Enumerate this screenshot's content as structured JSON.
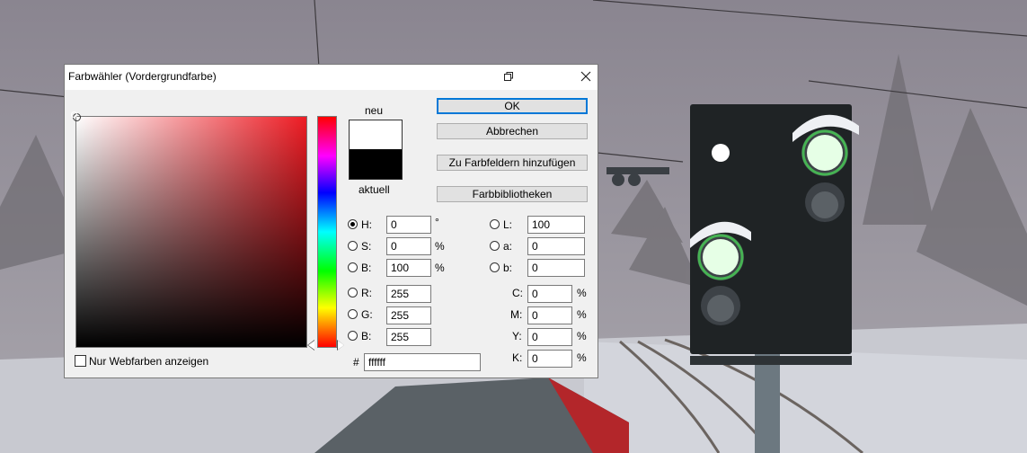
{
  "dialog": {
    "title": "Farbwähler (Vordergrundfarbe)",
    "buttons": {
      "ok": "OK",
      "cancel": "Abbrechen",
      "add_to_swatches": "Zu Farbfeldern hinzufügen",
      "color_libraries": "Farbbibliotheken"
    },
    "preview": {
      "new_label": "neu",
      "current_label": "aktuell",
      "new_color": "#ffffff",
      "current_color": "#000000"
    },
    "webcolors_label": "Nur Webfarben anzeigen",
    "webcolors_checked": false,
    "selected_hue_color": "#ee1c24",
    "hsb": {
      "h": {
        "label": "H:",
        "value": "0",
        "unit": "°",
        "selected": true
      },
      "s": {
        "label": "S:",
        "value": "0",
        "unit": "%"
      },
      "b": {
        "label": "B:",
        "value": "100",
        "unit": "%"
      }
    },
    "rgb": {
      "r": {
        "label": "R:",
        "value": "255"
      },
      "g": {
        "label": "G:",
        "value": "255"
      },
      "b": {
        "label": "B:",
        "value": "255"
      }
    },
    "lab": {
      "l": {
        "label": "L:",
        "value": "100"
      },
      "a": {
        "label": "a:",
        "value": "0"
      },
      "b": {
        "label": "b:",
        "value": "0"
      }
    },
    "cmyk": {
      "c": {
        "label": "C:",
        "value": "0",
        "unit": "%"
      },
      "m": {
        "label": "M:",
        "value": "0",
        "unit": "%"
      },
      "y": {
        "label": "Y:",
        "value": "0",
        "unit": "%"
      },
      "k": {
        "label": "K:",
        "value": "0",
        "unit": "%"
      }
    },
    "hex": {
      "label": "#",
      "value": "ffffff"
    }
  }
}
